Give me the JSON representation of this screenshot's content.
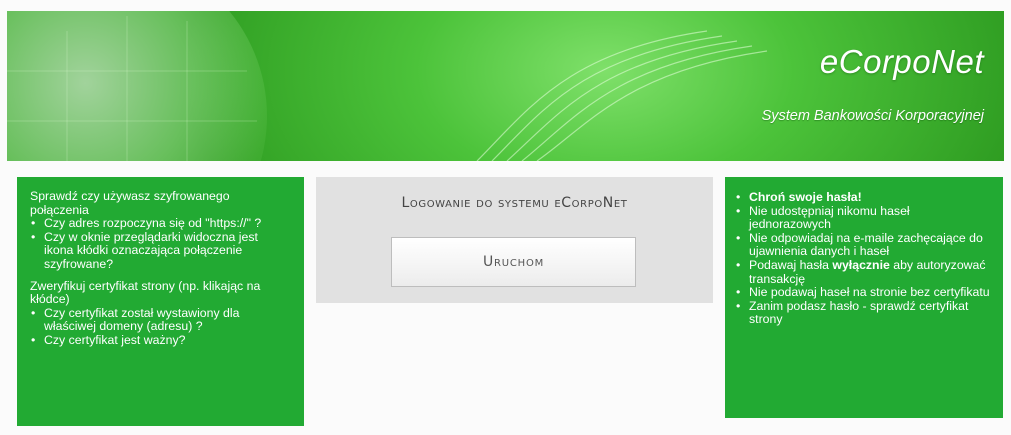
{
  "banner": {
    "title": "eCorpoNet",
    "subtitle": "System Bankowości Korporacyjnej"
  },
  "login": {
    "heading": "Logowanie do systemu eCorpoNet",
    "button_label": "Uruchom"
  },
  "left_panel": {
    "section1_title": "Sprawdź czy używasz szyfrowanego połączenia",
    "section1_items": [
      "Czy adres rozpoczyna się od \"https://\" ?",
      "Czy w oknie przeglądarki widoczna jest ikona kłódki oznaczająca połączenie szyfrowane?"
    ],
    "section2_title": "Zweryfikuj certyfikat strony (np. klikając na kłódce)",
    "section2_items": [
      "Czy certyfikat został wystawiony dla właściwej domeny (adresu) ?",
      "Czy certyfikat jest ważny?"
    ]
  },
  "right_panel": {
    "item1_bold": "Chroń swoje hasła",
    "item1_suffix": "!",
    "item2": "Nie udostępniaj nikomu haseł jednorazowych",
    "item3": "Nie odpowiadaj na e-maile zachęcające do ujawnienia danych i haseł",
    "item4_prefix": "Podawaj hasła ",
    "item4_bold": "wyłącznie",
    "item4_suffix": " aby autoryzować transakcję",
    "item5": "Nie podawaj haseł na stronie bez certyfikatu",
    "item6": "Zanim podasz hasło - sprawdź certyfikat strony"
  },
  "colors": {
    "panel_green": "#22aa33",
    "banner_green": "#4cc33a",
    "login_bg": "#e1e1e1"
  }
}
